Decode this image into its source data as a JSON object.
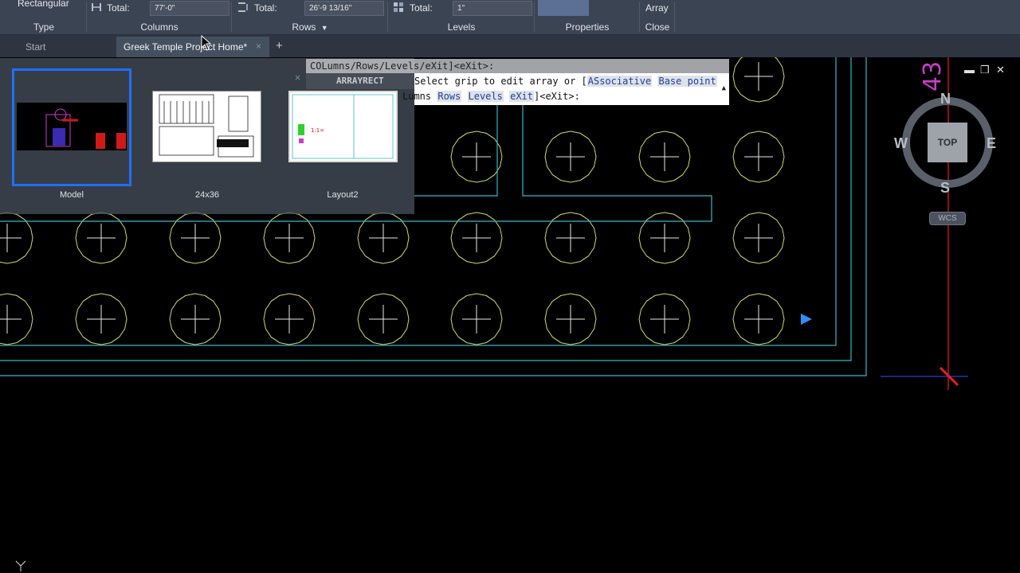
{
  "ribbon": {
    "type_panel": {
      "value": "Rectangular",
      "title": "Type"
    },
    "columns_panel": {
      "label": "Total:",
      "value": "77'-0\"",
      "title": "Columns"
    },
    "rows_panel": {
      "label": "Total:",
      "value": "26'-9 13/16\"",
      "title": "Rows"
    },
    "levels_panel": {
      "label": "Total:",
      "value": "1\"",
      "title": "Levels"
    },
    "properties_panel": {
      "title": "Properties"
    },
    "close_panel": {
      "label": "Array",
      "title": "Close"
    }
  },
  "tabs": {
    "start": "Start",
    "document": "Greek Temple Project Home*",
    "close": "×",
    "add": "+"
  },
  "layouts": [
    {
      "name": "Model",
      "active": true
    },
    {
      "name": "24x36",
      "active": false
    },
    {
      "name": "Layout2",
      "active": false
    }
  ],
  "command_line": {
    "history": "COLumns/Rows/Levels/eXit]<eXit>:",
    "prompt_cmd": "ARRAYRECT",
    "prompt_text": "Select grip to edit array or [",
    "keyword_assoc": "ASsociative",
    "keyword_base": "Base point",
    "line3_prefix": "Lumns",
    "keyword_rows": "Rows",
    "keyword_levels": "Levels",
    "keyword_exit": "eXit",
    "line3_suffix": "]<eXit>:"
  },
  "viewcube": {
    "north": "N",
    "south": "S",
    "east": "E",
    "west": "W",
    "face": "TOP",
    "wcs": "WCS"
  },
  "colors": {
    "ribbon_bg": "#3b4453",
    "column_circle": "#d4d66a",
    "boundary_line": "#3bb6c4",
    "ucs_red": "#e8202a",
    "selection_blue": "#1f6fff",
    "magenta_text": "#c83ec8"
  },
  "icons": {
    "columns": "columns-icon",
    "rows": "rows-icon",
    "levels": "levels-icon",
    "grip": "grip-arrow-icon",
    "ucs": "ucs-icon"
  }
}
